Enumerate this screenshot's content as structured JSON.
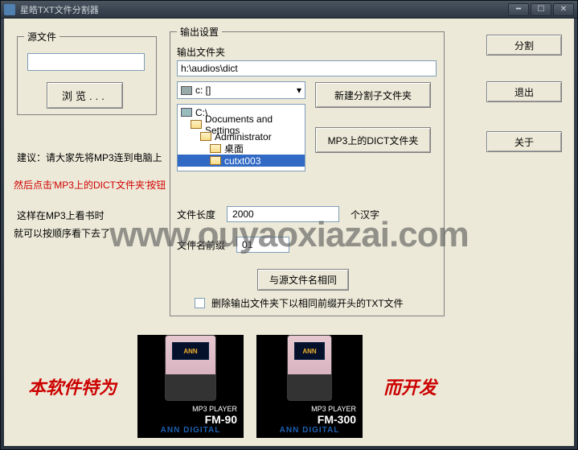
{
  "window": {
    "title": "星皓TXT文件分割器"
  },
  "source": {
    "legend": "源文件",
    "browse_label": "浏览..."
  },
  "instructions": {
    "line1": "建议：请大家先将MP3连到电脑上",
    "line2": "然后点击'MP3上的DICT文件夹'按钮",
    "line3": "这样在MP3上看书时",
    "line4": "就可以按顺序看下去了"
  },
  "output": {
    "legend": "输出设置",
    "folder_label": "输出文件夹",
    "folder_path": "h:\\audios\\dict",
    "drive_display": "c: []",
    "tree": {
      "root": "C:\\",
      "n1": "Documents and Settings",
      "n2": "Administrator",
      "n3": "桌面",
      "n4": "cutxt003"
    },
    "btn_new_sub": "新建分割子文件夹",
    "btn_dict": "MP3上的DICT文件夹",
    "file_len_label": "文件长度",
    "file_len_value": "2000",
    "file_len_unit": "个汉字",
    "prefix_label": "文件名前缀",
    "prefix_value": "01",
    "btn_same_src": "与源文件名相同",
    "chk_label": "删除输出文件夹下以相同前缀开头的TXT文件"
  },
  "side": {
    "split": "分割",
    "exit": "退出",
    "about": "关于"
  },
  "products": {
    "left_text": "本软件特为",
    "right_text": "而开发",
    "brand": "ANN",
    "small": "MP3 PLAYER",
    "model1a": "FM-90",
    "model1b": "ANN DIGITAL",
    "model2a": "FM-300",
    "model2b": "ANN DIGITAL"
  },
  "watermark": "www.ouyaoxiazai.com"
}
